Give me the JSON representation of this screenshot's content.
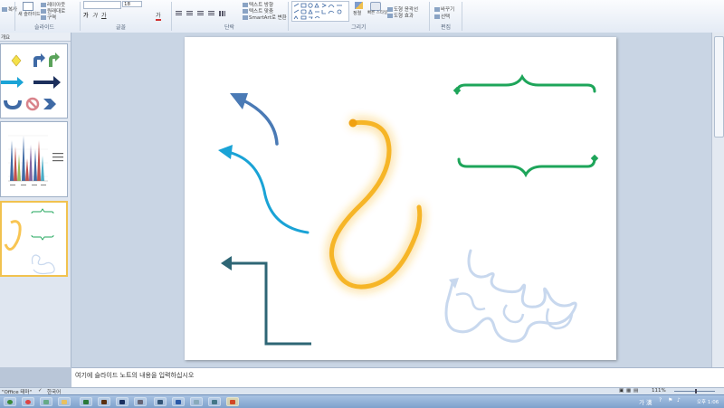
{
  "ribbon": {
    "slides_group": {
      "label": "슬라이드",
      "new_slide": "새 슬라이드",
      "layout": "레이아웃",
      "reset": "원래대로",
      "section": "구역"
    },
    "font_group": {
      "label": "글꼴",
      "font_size": "18"
    },
    "paragraph_group": {
      "label": "단락",
      "text_direction": "텍스트 방향",
      "align_text": "텍스트 맞춤",
      "smartart": "SmartArt로 변환"
    },
    "drawing_group": {
      "label": "그리기",
      "arrange": "정렬",
      "quick_styles": "빠른 스타일",
      "shape_effects": "도형 효과",
      "shape_fill": "도형 윤곽선"
    },
    "editing_group": {
      "label": "편집",
      "replace": "바꾸기",
      "select": "선택"
    },
    "clipboard_partial": "복사"
  },
  "left_panel": {
    "tab_label": "개요"
  },
  "notes": {
    "placeholder": "여기에 슬라이드 노트의 내용을 입력하십시오"
  },
  "status": {
    "theme": "\"Office 테마\"",
    "language": "한국어",
    "zoom": "111%"
  },
  "taskbar": {
    "ime": "가 漢",
    "clock": "오후 1:06"
  },
  "colors": {
    "arrow_blue": "#4a7ab5",
    "arrow_cyan": "#1aa3d6",
    "arrow_teal": "#2e6675",
    "hook_orange": "#f6b21a",
    "brace_green": "#1ea55a",
    "scribble_blue": "#c8d8ee",
    "ribbon_bg": "#e4ebf5"
  },
  "slide_shapes": [
    {
      "name": "curved-arrow-blue",
      "icon": "curved-arrow"
    },
    {
      "name": "curved-arrow-cyan",
      "icon": "s-curve-arrow"
    },
    {
      "name": "elbow-arrow-teal",
      "icon": "elbow-arrow"
    },
    {
      "name": "hook-curve-orange",
      "icon": "hook"
    },
    {
      "name": "brace-top-green",
      "icon": "curly-brace"
    },
    {
      "name": "brace-bottom-green",
      "icon": "curly-brace"
    },
    {
      "name": "scribble-loops-blue",
      "icon": "freeform-scribble"
    }
  ]
}
